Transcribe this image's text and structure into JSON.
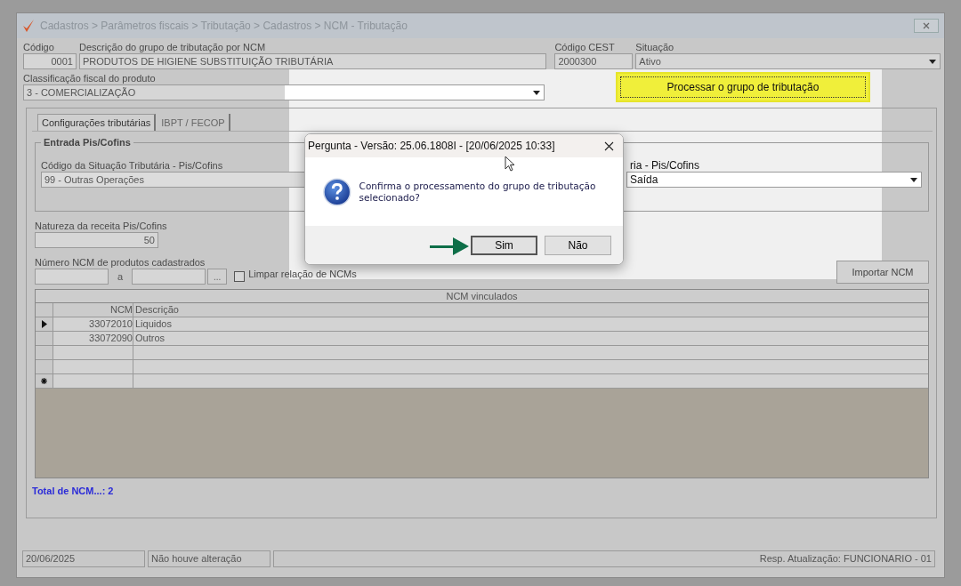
{
  "window": {
    "title": "Cadastros > Parâmetros fiscais > Tributação > Cadastros > NCM - Tributação"
  },
  "header": {
    "code_label": "Código",
    "code": "0001",
    "description_label": "Descrição do grupo de tributação por NCM",
    "description": "PRODUTOS DE HIGIENE SUBSTITUIÇÃO TRIBUTÁRIA",
    "cest_label": "Código CEST",
    "cest": "2000300",
    "status_label": "Situação",
    "status": "Ativo",
    "classification_label": "Classificação fiscal do produto",
    "classification": "3 - COMERCIALIZAÇÃO",
    "process_button": "Processar o grupo de tributação"
  },
  "tabs": [
    {
      "label": "Configurações tributárias",
      "selected": true
    },
    {
      "label": "IBPT / FECOP",
      "selected": false
    }
  ],
  "entrada_group": {
    "title": "Entrada Pis/Cofins",
    "cst_label": "Código da Situação Tributária - Pis/Cofins",
    "cst": "99 -  Outras Operações",
    "column_2_label": "ria - Pis/Cofins",
    "column_2_value": "Saída"
  },
  "natureza": {
    "label": "Natureza da receita Pis/Cofins",
    "value": "50"
  },
  "ncm_range": {
    "label": "Número  NCM de produtos cadastrados",
    "separator": "a",
    "browse_button": "...",
    "clear_checkbox": {
      "label": "Limpar relação de NCMs",
      "checked": false
    }
  },
  "import_button": "Importar NCM",
  "grid": {
    "title": "NCM vinculados",
    "columns": [
      "NCM",
      "Descrição"
    ],
    "rows": [
      {
        "kind": "data",
        "ncm": "33072010",
        "description": "Liquidos",
        "current": true
      },
      {
        "kind": "data",
        "ncm": "33072090",
        "description": "Outros",
        "current": false
      },
      {
        "kind": "empty"
      },
      {
        "kind": "empty"
      },
      {
        "kind": "new"
      }
    ]
  },
  "total": "Total de NCM...: 2",
  "status_bar": [
    "20/06/2025",
    "Não houve alteração",
    "Resp. Atualização: FUNCIONARIO - 01"
  ],
  "dialog": {
    "title": "Pergunta - Versão: 25.06.1808I - [20/06/2025 10:33]",
    "message": "Confirma o processamento do grupo de tributação selecionado?",
    "buttons": [
      {
        "label": "Sim",
        "focused": true
      },
      {
        "label": "Não",
        "focused": false
      }
    ]
  }
}
